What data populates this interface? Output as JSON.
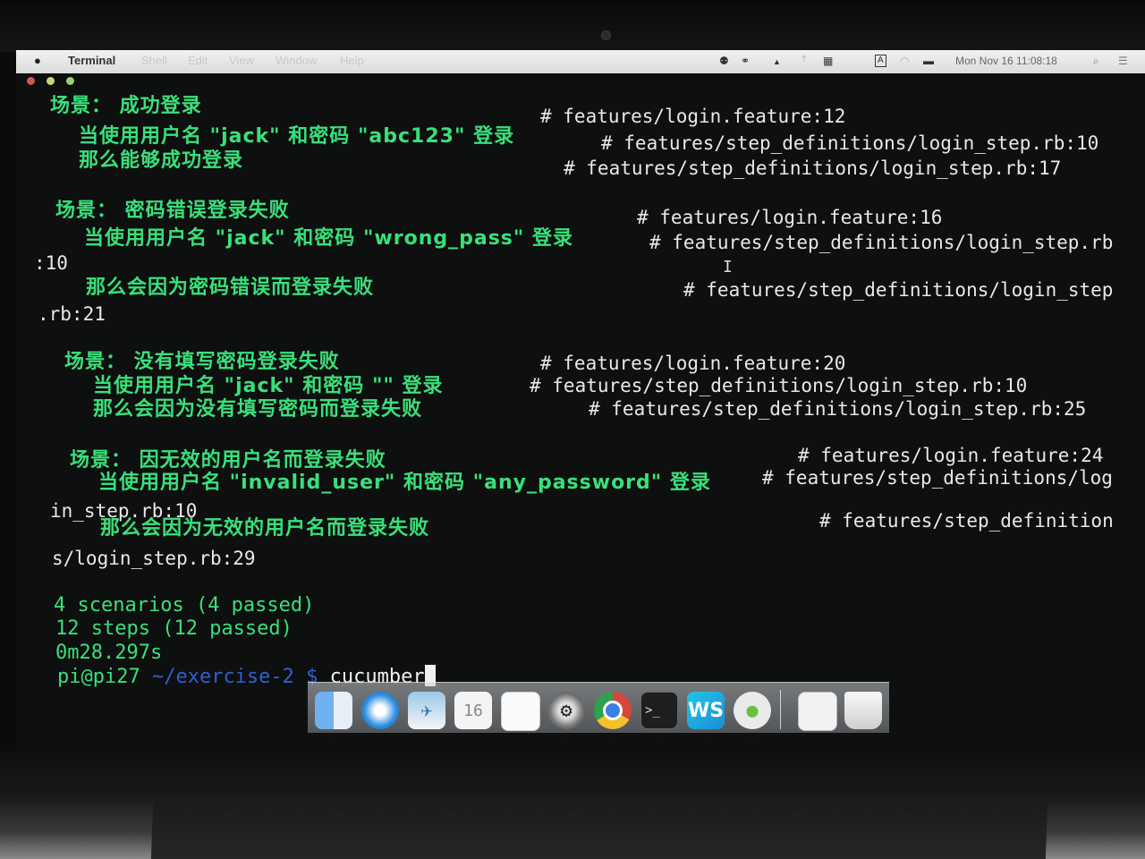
{
  "menubar": {
    "apple": "",
    "app": "Terminal",
    "menus": [
      "Shell",
      "Edit",
      "View",
      "Window",
      "Help"
    ],
    "clock": "Mon Nov 16  11:08:18"
  },
  "terminal": {
    "s1": {
      "title": "场景： 成功登录",
      "title_ref": "# features/login.feature:12",
      "step1": "当使用用户名 \"jack\" 和密码 \"abc123\" 登录",
      "step1_ref": "# features/step_definitions/login_step.rb:10",
      "step2": "那么能够成功登录",
      "step2_ref": "# features/step_definitions/login_step.rb:17"
    },
    "s2": {
      "title": "场景： 密码错误登录失败",
      "title_ref": "# features/login.feature:16",
      "step1": "当使用用户名 \"jack\" 和密码 \"wrong_pass\" 登录",
      "step1_ref": "# features/step_definitions/login_step.rb",
      "step1_ref_cont": ":10",
      "step2": "那么会因为密码错误而登录失败",
      "step2_ref": "# features/step_definitions/login_step",
      "step2_ref_cont": ".rb:21"
    },
    "s3": {
      "title": "场景： 没有填写密码登录失败",
      "title_ref": "# features/login.feature:20",
      "step1": "当使用用户名 \"jack\" 和密码 \"\" 登录",
      "step1_ref": "# features/step_definitions/login_step.rb:10",
      "step2": "那么会因为没有填写密码而登录失败",
      "step2_ref": "# features/step_definitions/login_step.rb:25"
    },
    "s4": {
      "title": "场景： 因无效的用户名而登录失败",
      "title_ref": "# features/login.feature:24",
      "step1": "当使用用户名 \"invalid_user\" 和密码 \"any_password\" 登录",
      "step1_ref": "# features/step_definitions/log",
      "step1_ref_cont": "in_step.rb:10",
      "step2": "那么会因为无效的用户名而登录失败",
      "step2_ref": "# features/step_definition",
      "step2_ref_cont": "s/login_step.rb:29"
    },
    "summary": {
      "scenarios": "4 scenarios (4 passed)",
      "steps": "12 steps (12 passed)",
      "time": "0m28.297s"
    },
    "prompt": {
      "user": "pi@pi27",
      "path": "~/exercise-2 $",
      "command": "cucumber"
    }
  },
  "dock": {
    "calendar_day": "16",
    "apps": [
      "finder-icon",
      "safari-icon",
      "preview-icon",
      "calendar-icon",
      "textedit-icon",
      "system-preferences-icon",
      "chrome-icon",
      "terminal-icon",
      "webstorm-icon",
      "wechat-icon",
      "documents-icon",
      "trash-icon"
    ]
  }
}
